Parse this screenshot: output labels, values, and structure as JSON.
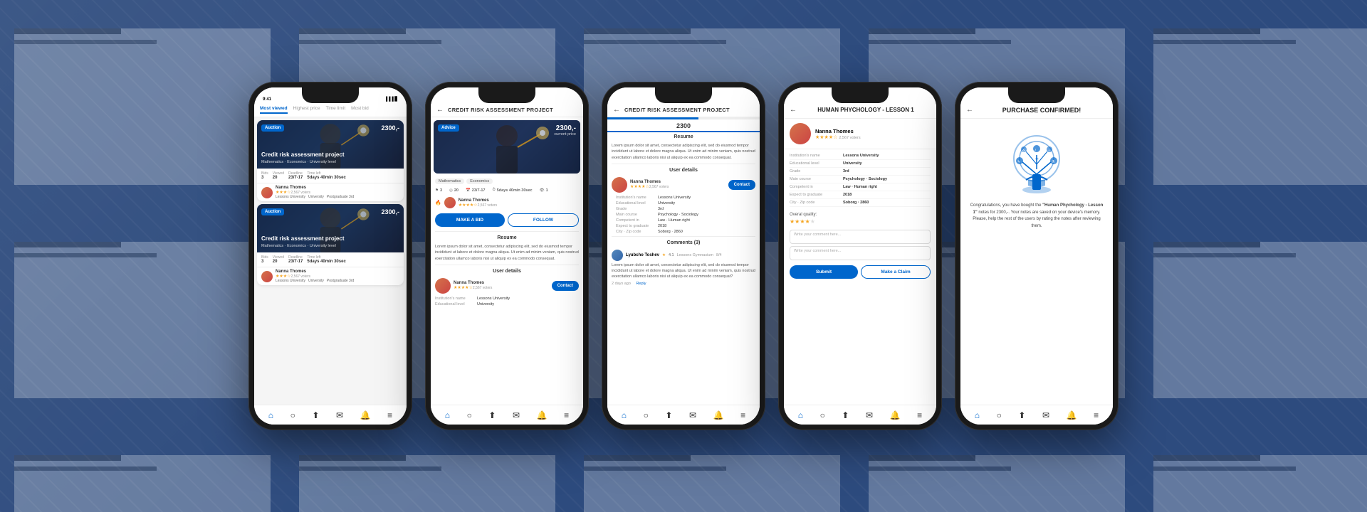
{
  "phones": [
    {
      "id": "phone1",
      "nav_tabs": [
        "Most viewed",
        "Highest price",
        "Time limit",
        "Most bid"
      ],
      "active_tab": 0,
      "cards": [
        {
          "badge": "Auction",
          "price": "2300,-",
          "title": "Credit risk assessment project",
          "tags": "Mathematics · Economics · University level",
          "bids": "3",
          "viewed": "20",
          "deadline": "23/7-17",
          "time_left": "5days 40min 30sec",
          "author_name": "Nanna Thomes",
          "stars": "★★★☆",
          "star_count": "2,567 voters",
          "inst": "Lessons University",
          "level": "University",
          "grade": "Postgraduate 3rd"
        },
        {
          "badge": "Auction",
          "price": "2300,-",
          "title": "Credit risk assessment project",
          "tags": "Mathematics · Economics · University level",
          "bids": "3",
          "viewed": "20",
          "deadline": "23/7-17",
          "time_left": "5days 40min 30sec",
          "author_name": "Nanna Thomes",
          "stars": "★★★☆",
          "star_count": "2,567 voters",
          "inst": "Lessons University",
          "level": "University",
          "grade": "Postgraduate 3rd"
        }
      ]
    },
    {
      "id": "phone2",
      "title": "CREDIT RISK ASSESSMENT PROJECT",
      "badge": "Advice",
      "price": "2300,-",
      "price_label": "current price",
      "tags": [
        "Mathematics",
        "Economics"
      ],
      "bids": "3",
      "viewed": "20",
      "deadline": "23/7-17",
      "time_left": "5days 40min 30sec",
      "follow_in": "1",
      "author_name": "Nanna Thomes",
      "stars": "★★★★☆",
      "star_count": "2,567 voters",
      "btn_bid": "MAKE A BID",
      "btn_follow": "FOLLOW",
      "section_resume": "Resume",
      "resume_text": "Lorem ipsum dolor sit amet, consectetur adipiscing elit, sed do eiusmod tempor incididunt ut labore et dolore magna aliqua. Ut enim ad minim veniam, quis nostrud exercitation ullamco laboris nisi ut aliquip ex ea commodo consequat.",
      "section_user": "User details",
      "author2_name": "Nanna Thomes",
      "author2_stars": "★★★★☆",
      "author2_star_count": "2,567 voters",
      "user_details": [
        {
          "label": "Institution's name",
          "value": "Lessons University"
        },
        {
          "label": "Educational level",
          "value": "University"
        }
      ]
    },
    {
      "id": "phone3",
      "title": "CREDIT RISK ASSESSMENT PROJECT",
      "price": "2300",
      "section_resume": "Resume",
      "resume_text": "Lorem ipsum dolor sit amet, consectetur adipiscing elit, sed do eiusmod tempor incididunt ut labore et dolore magna aliqua. Ut enim ad minim veniam, quis nostrud exercitation ullamco laboris nisi ut aliquip ex ea commodo consequat.",
      "section_user": "User details",
      "author_name": "Nanna Thomes",
      "stars": "★★★★☆",
      "star_count": "2,567 voters",
      "btn_contact": "Contact",
      "user_details": [
        {
          "label": "Institution's name",
          "value": "Lessons University"
        },
        {
          "label": "Educational level",
          "value": "University"
        },
        {
          "label": "Grade",
          "value": "3rd"
        },
        {
          "label": "Main course",
          "value": "Psychology · Sociology"
        },
        {
          "label": "Competent in",
          "value": "Law · Human right"
        },
        {
          "label": "Expect to graduate",
          "value": "2018"
        },
        {
          "label": "City · Zip code",
          "value": "Soborg · 2860"
        }
      ],
      "section_comments": "Comments (3)",
      "comment_author": "Lyubcho Toshev",
      "comment_rating": "4.1",
      "comment_inst": "Lessons Gymnasium",
      "comment_grade": "8/4",
      "comment_text": "Lorem ipsum dolor sit amet, consectetur adipiscing elit, sed do eiusmod tempor incididunt ut labore et dolore magna aliqua. Ut enim ad minim veniam, quis nostrud exercitation ullamco laboris nisi ut aliquip ex ea commodo consequat?",
      "comment_time": "2 days ago",
      "btn_reply": "Reply"
    },
    {
      "id": "phone4",
      "title": "HUMAN PHYCHOLOGY - LESSON 1",
      "author_name": "Nanna Thomes",
      "stars": "★★★★☆",
      "star_count": "2,567 voters",
      "details": [
        {
          "label": "Institution's name",
          "value": "Lessons University"
        },
        {
          "label": "Educational level",
          "value": "University"
        },
        {
          "label": "Grade",
          "value": "3rd"
        },
        {
          "label": "Main course",
          "value": "Psychology · Sociology"
        },
        {
          "label": "Competent in",
          "value": "Law · Human right"
        },
        {
          "label": "Expect to graduate",
          "value": "2018"
        },
        {
          "label": "City · Zip code",
          "value": "Soborg · 2860"
        }
      ],
      "quality_label": "Overal quality:",
      "quality_stars": "★★★★☆",
      "comment_placeholder1": "Write your comment here...",
      "comment_placeholder2": "Write your comment here...",
      "btn_submit": "Submit",
      "btn_claim": "Make a Claim"
    },
    {
      "id": "phone5",
      "title": "PURCHASE CONFIRMED!",
      "congrats_text_1": "Congratulations, you have bought the",
      "congrats_notes": "\"Human Phychology - Lesson 1\"",
      "congrats_text_2": "notes for 2300,-. Your notes are saved on your device's memory. Please, help the rest of the users by rating the notes after reviewing them."
    }
  ],
  "colors": {
    "primary": "#0066cc",
    "accent": "#f5a623",
    "dark": "#1a1a2e",
    "text": "#333",
    "light": "#f5f5f5"
  }
}
